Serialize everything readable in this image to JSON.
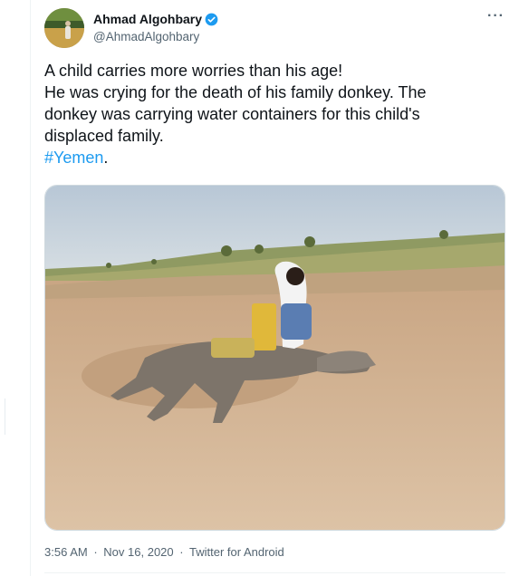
{
  "tweet": {
    "author": {
      "name": "Ahmad Algohbary",
      "handle": "@AhmadAlgohbary",
      "verified_icon": "verified-badge-icon"
    },
    "more_icon": "more-horizontal-icon",
    "text_lines": [
      "A child carries more worries than his age!",
      "He was crying for the death of his family donkey. The",
      "donkey was carrying water containers for this child's",
      "displaced family."
    ],
    "hashtag": "#Yemen",
    "hashtag_suffix": ".",
    "media": {
      "kind": "photo"
    },
    "meta": {
      "time": "3:56 AM",
      "sep1": "·",
      "date": "Nov 16, 2020",
      "sep2": "·",
      "source": "Twitter for Android"
    }
  },
  "colors": {
    "link": "#1d9bf0",
    "secondary_text": "#536471",
    "verified": "#1d9bf0"
  }
}
